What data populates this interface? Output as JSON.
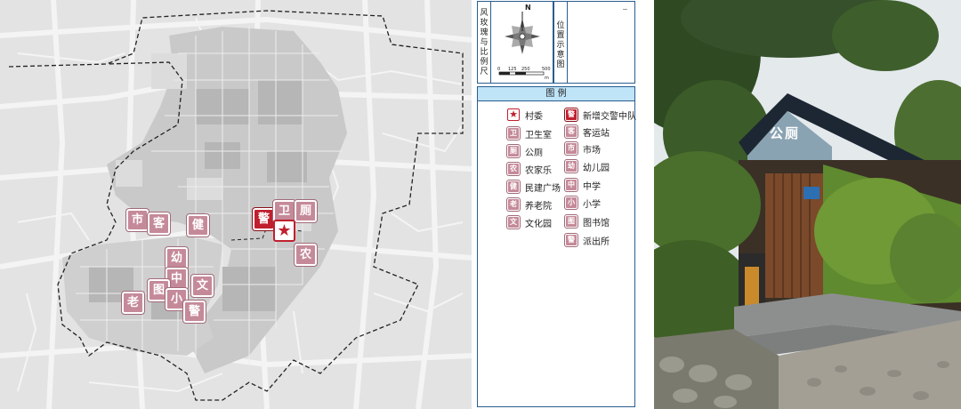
{
  "map": {
    "markers": [
      {
        "label": "市",
        "color": "pink"
      },
      {
        "label": "客",
        "color": "pink"
      },
      {
        "label": "健",
        "color": "pink"
      },
      {
        "label": "警",
        "color": "red"
      },
      {
        "label": "卫",
        "color": "pink"
      },
      {
        "label": "厕",
        "color": "pink"
      },
      {
        "label": "农",
        "color": "pink"
      },
      {
        "label": "幼",
        "color": "pink"
      },
      {
        "label": "中",
        "color": "pink"
      },
      {
        "label": "文",
        "color": "pink"
      },
      {
        "label": "图",
        "color": "pink"
      },
      {
        "label": "小",
        "color": "pink"
      },
      {
        "label": "老",
        "color": "pink"
      },
      {
        "label": "警",
        "color": "pink"
      }
    ],
    "village_committee_icon": "star-icon"
  },
  "compass": {
    "title": "风玫瑰与比例尺",
    "north": "N",
    "scale_ticks": [
      "0",
      "125",
      "250",
      "500"
    ],
    "scale_unit": "m"
  },
  "location": {
    "title": "位置示意图"
  },
  "legend": {
    "title": "图  例",
    "left": [
      {
        "icon": "★",
        "label": "村委",
        "style": "star"
      },
      {
        "icon": "卫",
        "label": "卫生室",
        "style": "pink"
      },
      {
        "icon": "厕",
        "label": "公厕",
        "style": "pink"
      },
      {
        "icon": "农",
        "label": "农家乐",
        "style": "pink"
      },
      {
        "icon": "健",
        "label": "民建广场",
        "style": "pink"
      },
      {
        "icon": "老",
        "label": "养老院",
        "style": "pink"
      },
      {
        "icon": "文",
        "label": "文化园",
        "style": "pink"
      }
    ],
    "right": [
      {
        "icon": "警",
        "label": "新增交警中队",
        "style": "red"
      },
      {
        "icon": "客",
        "label": "客运站",
        "style": "pink"
      },
      {
        "icon": "市",
        "label": "市场",
        "style": "pink"
      },
      {
        "icon": "幼",
        "label": "幼儿园",
        "style": "pink"
      },
      {
        "icon": "中",
        "label": "中学",
        "style": "pink"
      },
      {
        "icon": "小",
        "label": "小学",
        "style": "pink"
      },
      {
        "icon": "图",
        "label": "图书馆",
        "style": "pink"
      },
      {
        "icon": "警",
        "label": "派出所",
        "style": "pink"
      }
    ]
  },
  "photo": {
    "sign_text": "公厕"
  },
  "colors": {
    "marker_pink": "#c58a99",
    "marker_red": "#c0202e",
    "legend_header_bg": "#bfe4f7",
    "frame_border": "#2a5d8f",
    "map_background": "#e3e3e3",
    "built_area": "#c9c9c9"
  }
}
